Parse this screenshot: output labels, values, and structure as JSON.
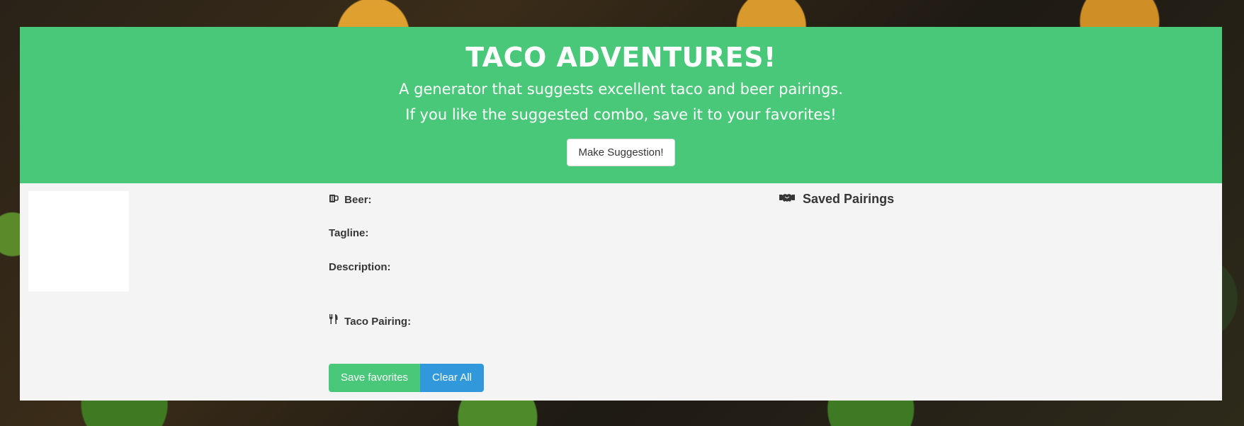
{
  "header": {
    "title": "TACO ADVENTURES!",
    "subtitle_line1": "A generator that suggests excellent taco and beer pairings.",
    "subtitle_line2": "If you like the suggested combo, save it to your favorites!",
    "suggest_button": "Make Suggestion!"
  },
  "details": {
    "beer_label": "Beer:",
    "beer_value": "",
    "tagline_label": "Tagline:",
    "tagline_value": "",
    "description_label": "Description:",
    "description_value": "",
    "taco_label": "Taco Pairing:",
    "taco_value": ""
  },
  "buttons": {
    "save": "Save favorites",
    "clear": "Clear All"
  },
  "saved": {
    "title": "Saved Pairings"
  },
  "icons": {
    "beer": "beer-mug-icon",
    "taco": "utensils-icon",
    "saved": "handshake-icon"
  },
  "colors": {
    "primary": "#48c878",
    "info": "#3298dc",
    "panel": "#f4f4f4"
  }
}
